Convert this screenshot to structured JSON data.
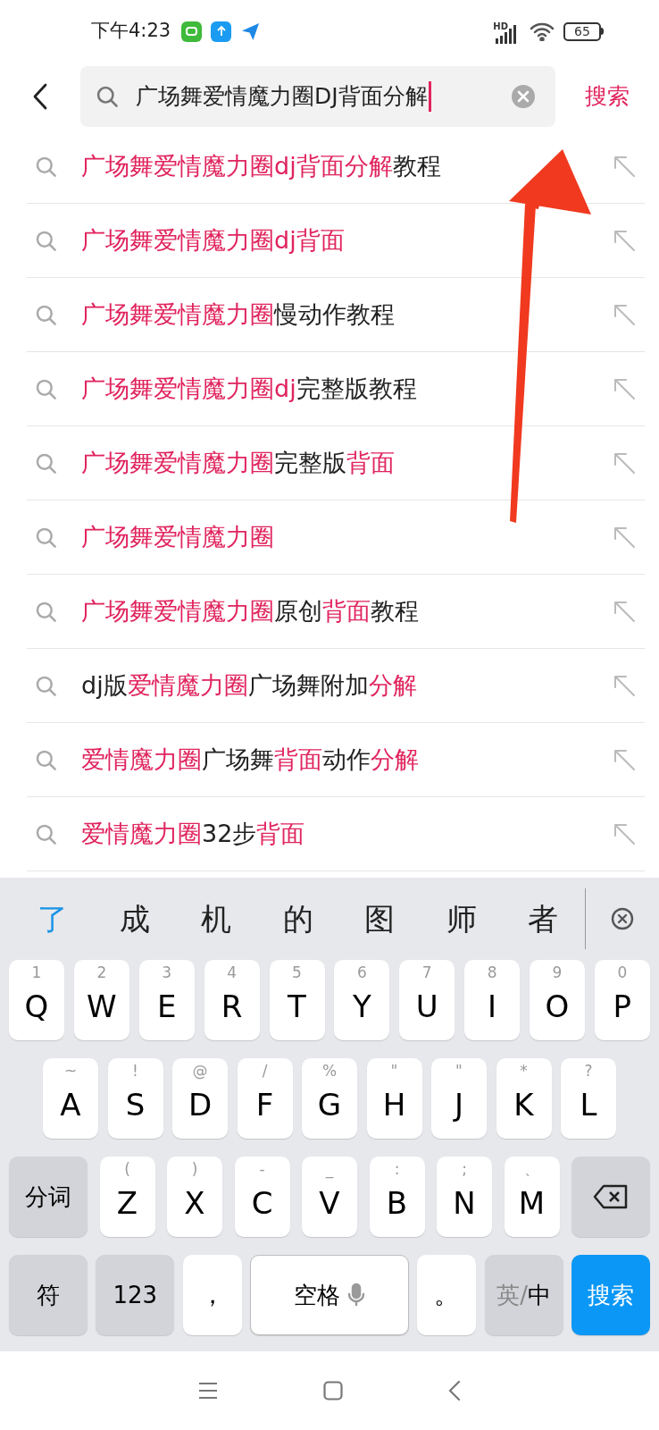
{
  "status_bar": {
    "time": "下午4:23",
    "network": "HD",
    "battery": "65"
  },
  "search": {
    "value": "广场舞爱情魔力圈DJ背面分解",
    "submit": "搜索"
  },
  "suggestions": [
    {
      "parts": [
        {
          "text": "广场舞爱情魔力圈dj背面分解",
          "highlight": true
        },
        {
          "text": "教程",
          "highlight": false
        }
      ]
    },
    {
      "parts": [
        {
          "text": "广场舞爱情魔力圈dj背面",
          "highlight": true
        }
      ]
    },
    {
      "parts": [
        {
          "text": "广场舞爱情魔力圈",
          "highlight": true
        },
        {
          "text": "慢动作教程",
          "highlight": false
        }
      ]
    },
    {
      "parts": [
        {
          "text": "广场舞爱情魔力圈dj",
          "highlight": true
        },
        {
          "text": "完整版教程",
          "highlight": false
        }
      ]
    },
    {
      "parts": [
        {
          "text": "广场舞爱情魔力圈",
          "highlight": true
        },
        {
          "text": "完整版",
          "highlight": false
        },
        {
          "text": "背面",
          "highlight": true
        }
      ]
    },
    {
      "parts": [
        {
          "text": "广场舞爱情魔力圈",
          "highlight": true
        }
      ]
    },
    {
      "parts": [
        {
          "text": "广场舞爱情魔力圈",
          "highlight": true
        },
        {
          "text": "原创",
          "highlight": false
        },
        {
          "text": "背面",
          "highlight": true
        },
        {
          "text": "教程",
          "highlight": false
        }
      ]
    },
    {
      "parts": [
        {
          "text": "dj版",
          "highlight": false
        },
        {
          "text": "爱情魔力圈",
          "highlight": true
        },
        {
          "text": "广场舞附加",
          "highlight": false
        },
        {
          "text": "分解",
          "highlight": true
        }
      ]
    },
    {
      "parts": [
        {
          "text": "爱情魔力圈",
          "highlight": true
        },
        {
          "text": "广场舞",
          "highlight": false
        },
        {
          "text": "背面",
          "highlight": true
        },
        {
          "text": "动作",
          "highlight": false
        },
        {
          "text": "分解",
          "highlight": true
        }
      ]
    },
    {
      "parts": [
        {
          "text": "爱情魔力圈",
          "highlight": true
        },
        {
          "text": "32步",
          "highlight": false
        },
        {
          "text": "背面",
          "highlight": true
        }
      ]
    }
  ],
  "keyboard": {
    "candidates": [
      {
        "text": "了",
        "selected": true
      },
      {
        "text": "成",
        "selected": false
      },
      {
        "text": "机",
        "selected": false
      },
      {
        "text": "的",
        "selected": false
      },
      {
        "text": "图",
        "selected": false
      },
      {
        "text": "师",
        "selected": false
      },
      {
        "text": "者",
        "selected": false
      }
    ],
    "rows": [
      {
        "keys": [
          {
            "kind": "letter",
            "label": "Q",
            "hint": "1"
          },
          {
            "kind": "letter",
            "label": "W",
            "hint": "2"
          },
          {
            "kind": "letter",
            "label": "E",
            "hint": "3"
          },
          {
            "kind": "letter",
            "label": "R",
            "hint": "4"
          },
          {
            "kind": "letter",
            "label": "T",
            "hint": "5"
          },
          {
            "kind": "letter",
            "label": "Y",
            "hint": "6"
          },
          {
            "kind": "letter",
            "label": "U",
            "hint": "7"
          },
          {
            "kind": "letter",
            "label": "I",
            "hint": "8"
          },
          {
            "kind": "letter",
            "label": "O",
            "hint": "9"
          },
          {
            "kind": "letter",
            "label": "P",
            "hint": "0"
          }
        ]
      },
      {
        "keys": [
          {
            "kind": "letter",
            "label": "A",
            "hint": "~"
          },
          {
            "kind": "letter",
            "label": "S",
            "hint": "!"
          },
          {
            "kind": "letter",
            "label": "D",
            "hint": "@"
          },
          {
            "kind": "letter",
            "label": "F",
            "hint": "/"
          },
          {
            "kind": "letter",
            "label": "G",
            "hint": "%"
          },
          {
            "kind": "letter",
            "label": "H",
            "hint": "\""
          },
          {
            "kind": "letter",
            "label": "J",
            "hint": "\""
          },
          {
            "kind": "letter",
            "label": "K",
            "hint": "*"
          },
          {
            "kind": "letter",
            "label": "L",
            "hint": "?"
          }
        ]
      },
      {
        "keys": [
          {
            "kind": "function",
            "label": "分词"
          },
          {
            "kind": "letter",
            "label": "Z",
            "hint": "("
          },
          {
            "kind": "letter",
            "label": "X",
            "hint": ")"
          },
          {
            "kind": "letter",
            "label": "C",
            "hint": "-"
          },
          {
            "kind": "letter",
            "label": "V",
            "hint": "_"
          },
          {
            "kind": "letter",
            "label": "B",
            "hint": ":"
          },
          {
            "kind": "letter",
            "label": "N",
            "hint": ";"
          },
          {
            "kind": "letter",
            "label": "M",
            "hint": "、"
          },
          {
            "kind": "backspace"
          }
        ]
      },
      {
        "keys": [
          {
            "kind": "function",
            "label": "符"
          },
          {
            "kind": "function",
            "label": "123"
          },
          {
            "kind": "punct",
            "label": "，"
          },
          {
            "kind": "space",
            "label": "空格"
          },
          {
            "kind": "punct",
            "label": "。"
          },
          {
            "kind": "lang",
            "inactive": "英/",
            "active": "中"
          },
          {
            "kind": "action",
            "label": "搜索"
          }
        ]
      }
    ]
  }
}
